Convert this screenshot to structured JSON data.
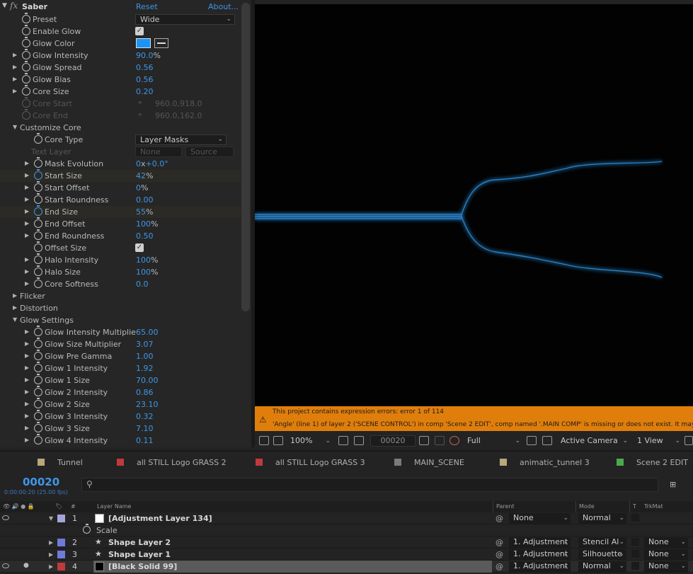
{
  "effect": {
    "name": "Saber",
    "reset_label": "Reset",
    "about_label": "About...",
    "fx_glyph": "fx"
  },
  "params": [
    {
      "label": "Preset",
      "kind": "dropdown",
      "value": "Wide",
      "indent": 0,
      "twirl": false
    },
    {
      "label": "Enable Glow",
      "kind": "checkbox",
      "indent": 0,
      "twirl": false
    },
    {
      "label": "Glow Color",
      "kind": "color",
      "color": "#1a95f6",
      "indent": 0,
      "twirl": false
    },
    {
      "label": "Glow Intensity",
      "kind": "num",
      "value": "90.0",
      "unit": "%",
      "indent": 0,
      "twirl": true
    },
    {
      "label": "Glow Spread",
      "kind": "num",
      "value": "0.56",
      "indent": 0,
      "twirl": true
    },
    {
      "label": "Glow Bias",
      "kind": "num",
      "value": "0.56",
      "indent": 0,
      "twirl": true
    },
    {
      "label": "Core Size",
      "kind": "num",
      "value": "0.20",
      "indent": 0,
      "twirl": true
    },
    {
      "label": "Core Start",
      "kind": "point",
      "value": "960.0,918.0",
      "indent": 0,
      "twirl": false,
      "disabled": true
    },
    {
      "label": "Core End",
      "kind": "point",
      "value": "960.0,162.0",
      "indent": 0,
      "twirl": false,
      "disabled": true
    },
    {
      "label": "Customize Core",
      "kind": "group",
      "indent": 0,
      "open": true
    },
    {
      "label": "Core Type",
      "kind": "dropdown",
      "value": "Layer Masks",
      "indent": 1,
      "twirl": false
    },
    {
      "label": "Text Layer",
      "kind": "layerpick",
      "value": "None",
      "value2": "Source",
      "indent": 1,
      "disabled": true,
      "nostop": true
    },
    {
      "label": "Mask Evolution",
      "kind": "num",
      "value": "0",
      "unit": "x",
      "value_b": "+0.0",
      "unit_b": "°",
      "indent": 1,
      "twirl": true
    },
    {
      "label": "Start Size",
      "kind": "num",
      "value": "42",
      "unit": "%",
      "indent": 1,
      "twirl": true,
      "keyed": true
    },
    {
      "label": "Start Offset",
      "kind": "num",
      "value": "0",
      "unit": "%",
      "indent": 1,
      "twirl": true
    },
    {
      "label": "Start Roundness",
      "kind": "num",
      "value": "0.00",
      "indent": 1,
      "twirl": true
    },
    {
      "label": "End Size",
      "kind": "num",
      "value": "55",
      "unit": "%",
      "indent": 1,
      "twirl": true,
      "keyed": true
    },
    {
      "label": "End Offset",
      "kind": "num",
      "value": "100",
      "unit": "%",
      "indent": 1,
      "twirl": true
    },
    {
      "label": "End Roundness",
      "kind": "num",
      "value": "0.50",
      "indent": 1,
      "twirl": true
    },
    {
      "label": "Offset Size",
      "kind": "checkbox",
      "indent": 1,
      "twirl": false
    },
    {
      "label": "Halo Intensity",
      "kind": "num",
      "value": "100",
      "unit": "%",
      "indent": 1,
      "twirl": true
    },
    {
      "label": "Halo Size",
      "kind": "num",
      "value": "100",
      "unit": "%",
      "indent": 1,
      "twirl": true
    },
    {
      "label": "Core Softness",
      "kind": "num",
      "value": "0.0",
      "indent": 1,
      "twirl": true
    },
    {
      "label": "Flicker",
      "kind": "group",
      "indent": 0,
      "open": false
    },
    {
      "label": "Distortion",
      "kind": "group",
      "indent": 0,
      "open": false
    },
    {
      "label": "Glow Settings",
      "kind": "group",
      "indent": 0,
      "open": true
    },
    {
      "label": "Glow Intensity Multiplie",
      "kind": "num",
      "value": "65.00",
      "indent": 1,
      "twirl": true
    },
    {
      "label": "Glow Size Multiplier",
      "kind": "num",
      "value": "3.07",
      "indent": 1,
      "twirl": true
    },
    {
      "label": "Glow Pre Gamma",
      "kind": "num",
      "value": "1.00",
      "indent": 1,
      "twirl": true
    },
    {
      "label": "Glow 1 Intensity",
      "kind": "num",
      "value": "1.92",
      "indent": 1,
      "twirl": true
    },
    {
      "label": "Glow 1 Size",
      "kind": "num",
      "value": "70.00",
      "indent": 1,
      "twirl": true
    },
    {
      "label": "Glow 2 Intensity",
      "kind": "num",
      "value": "0.86",
      "indent": 1,
      "twirl": true
    },
    {
      "label": "Glow 2 Size",
      "kind": "num",
      "value": "23.10",
      "indent": 1,
      "twirl": true
    },
    {
      "label": "Glow 3 Intensity",
      "kind": "num",
      "value": "0.32",
      "indent": 1,
      "twirl": true
    },
    {
      "label": "Glow 3 Size",
      "kind": "num",
      "value": "7.10",
      "indent": 1,
      "twirl": true
    },
    {
      "label": "Glow 4 Intensity",
      "kind": "num",
      "value": "0.11",
      "indent": 1,
      "twirl": true
    }
  ],
  "warning": {
    "line1": "This project contains expression errors: error 1 of 114",
    "line2": "'Angle' (line 1) of layer 2 ('SCENE CONTROL') in comp 'Scene 2 EDIT', comp named '.MAIN COMP' is missing or does not exist. It may h"
  },
  "viewer_toolbar": {
    "zoom": "100%",
    "timecode": "00020",
    "resolution": "Full",
    "camera": "Active Camera",
    "views": "1 View"
  },
  "timeline": {
    "tabs": [
      {
        "label": "Tunnel",
        "color": "#b8a77a"
      },
      {
        "label": "all STILL Logo GRASS 2",
        "color": "#c0393d"
      },
      {
        "label": "all STILL Logo GRASS 3",
        "color": "#c0393d"
      },
      {
        "label": "MAIN_SCENE",
        "color": "#7b7b7b"
      },
      {
        "label": "animatic_tunnel 3",
        "color": "#b8a77a"
      },
      {
        "label": "Scene 2 EDIT",
        "color": "#4bab4b"
      }
    ],
    "timecode": "00020",
    "timecode_sub": "0:00:00:20 (25.00 fps)",
    "search_placeholder": "",
    "headers": {
      "hash": "#",
      "layer_name": "Layer Name",
      "parent": "Parent",
      "mode": "Mode",
      "t": "T",
      "trkmat": "TrkMat"
    },
    "layers": [
      {
        "num": "1",
        "name": "[Adjustment Layer 134]",
        "label_color": "#a4a4dc",
        "type": "solid-white",
        "parent": "None",
        "mode": "Normal",
        "trkmat": "",
        "open": true,
        "eye": true,
        "audio": false,
        "solo": false
      },
      {
        "sub": true,
        "name": "Scale"
      },
      {
        "num": "2",
        "name": "Shape Layer 2",
        "label_color": "#6e7bdb",
        "type": "star",
        "parent": "1. Adjustment",
        "mode": "Stencil Al",
        "trkmat": "None",
        "open": false,
        "eye": false,
        "solo": false
      },
      {
        "num": "3",
        "name": "Shape Layer 1",
        "label_color": "#6e7bdb",
        "type": "star",
        "parent": "1. Adjustment",
        "mode": "Silhouette",
        "trkmat": "None",
        "open": false,
        "eye": false,
        "solo": false
      },
      {
        "num": "4",
        "name": "[Black Solid 99]",
        "label_color": "#c0393d",
        "type": "solid-black",
        "parent": "1. Adjustment",
        "mode": "Normal",
        "trkmat": "None",
        "open": false,
        "eye": true,
        "solo": true,
        "selected": true
      }
    ]
  },
  "colors": {
    "accent_blue": "#3e97e8",
    "warning_orange": "#e07e0c",
    "glow_color": "#1a95f6"
  }
}
